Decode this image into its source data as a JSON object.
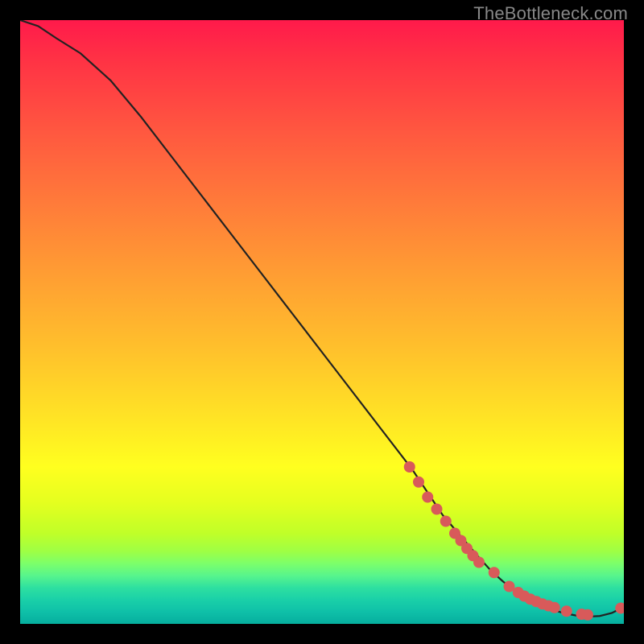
{
  "watermark": "TheBottleneck.com",
  "colors": {
    "gradient_top": "#ff1a4b",
    "gradient_mid": "#ffe425",
    "gradient_bottom": "#06ae9e",
    "curve": "#222222",
    "marker": "#d85a5a",
    "page_bg": "#000000"
  },
  "chart_data": {
    "type": "line",
    "title": "",
    "xlabel": "",
    "ylabel": "",
    "xlim": [
      0,
      100
    ],
    "ylim": [
      0,
      100
    ],
    "grid": false,
    "legend": false,
    "x": [
      0,
      3,
      6,
      10,
      15,
      20,
      25,
      30,
      35,
      40,
      45,
      50,
      55,
      60,
      65,
      68,
      70,
      73,
      76,
      78,
      80,
      82,
      84,
      86,
      88,
      90,
      92,
      94,
      96,
      98,
      100
    ],
    "values": [
      100,
      99,
      97,
      94.5,
      90,
      84,
      77.5,
      71,
      64.5,
      58,
      51.5,
      45,
      38.5,
      32,
      25.5,
      21,
      18,
      14.5,
      11,
      8.8,
      7.0,
      5.5,
      4.2,
      3.2,
      2.4,
      1.8,
      1.4,
      1.2,
      1.3,
      1.8,
      2.8
    ],
    "markers": {
      "x": [
        64.5,
        66,
        67.5,
        69,
        70.5,
        72,
        73,
        74,
        75,
        76,
        78.5,
        81,
        82.5,
        83.5,
        84.5,
        85.5,
        86.5,
        87.5,
        88.5,
        90.5,
        93,
        94,
        99.5
      ],
      "values": [
        26.0,
        23.5,
        21.0,
        19.0,
        17.0,
        15.0,
        13.8,
        12.5,
        11.3,
        10.2,
        8.5,
        6.2,
        5.2,
        4.6,
        4.1,
        3.7,
        3.3,
        3.0,
        2.7,
        2.1,
        1.6,
        1.5,
        2.6
      ]
    }
  }
}
